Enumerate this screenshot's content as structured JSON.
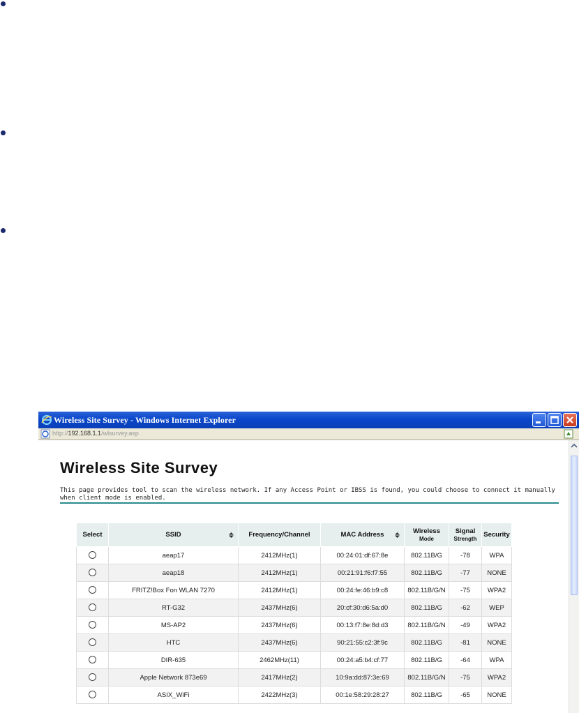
{
  "window": {
    "title": "Wireless Site Survey - Windows Internet Explorer",
    "url_prefix": "http://",
    "url_host": "192.168.1.1",
    "url_path": "/wlsurvey.asp"
  },
  "page": {
    "heading": "Wireless Site Survey",
    "description": "This page provides tool to scan the wireless network. If any Access Point or IBSS is found, you could choose to connect it manually when client mode is enabled."
  },
  "table": {
    "headers": {
      "select": "Select",
      "ssid": "SSID",
      "frequency": "Frequency/Channel",
      "mac": "MAC Address",
      "mode_line1": "Wireless",
      "mode_line2": "Mode",
      "signal_line1": "Signal",
      "signal_line2": "Strength",
      "security": "Security"
    },
    "rows": [
      {
        "ssid": "aeap17",
        "frequency": "2412MHz(1)",
        "mac": "00:24:01:df:67:8e",
        "mode": "802.11B/G",
        "signal": "-78",
        "security": "WPA"
      },
      {
        "ssid": "aeap18",
        "frequency": "2412MHz(1)",
        "mac": "00:21:91:f6:f7:55",
        "mode": "802.11B/G",
        "signal": "-77",
        "security": "NONE"
      },
      {
        "ssid": "FRITZ!Box Fon WLAN 7270",
        "frequency": "2412MHz(1)",
        "mac": "00:24:fe:46:b9:c8",
        "mode": "802.11B/G/N",
        "signal": "-75",
        "security": "WPA2"
      },
      {
        "ssid": "RT-G32",
        "frequency": "2437MHz(6)",
        "mac": "20:cf:30:d6:5a:d0",
        "mode": "802.11B/G",
        "signal": "-62",
        "security": "WEP"
      },
      {
        "ssid": "MS-AP2",
        "frequency": "2437MHz(6)",
        "mac": "00:13:f7:8e:8d:d3",
        "mode": "802.11B/G/N",
        "signal": "-49",
        "security": "WPA2"
      },
      {
        "ssid": "HTC",
        "frequency": "2437MHz(6)",
        "mac": "90:21:55:c2:3f:9c",
        "mode": "802.11B/G",
        "signal": "-81",
        "security": "NONE"
      },
      {
        "ssid": "DIR-635",
        "frequency": "2462MHz(11)",
        "mac": "00:24:a5:b4:cf:77",
        "mode": "802.11B/G",
        "signal": "-64",
        "security": "WPA"
      },
      {
        "ssid": "Apple Network 873e69",
        "frequency": "2417MHz(2)",
        "mac": "10:9a:dd:87:3e:69",
        "mode": "802.11B/G/N",
        "signal": "-75",
        "security": "WPA2"
      },
      {
        "ssid": "ASIX_WiFi",
        "frequency": "2422MHz(3)",
        "mac": "00:1e:58:29:28:27",
        "mode": "802.11B/G",
        "signal": "-65",
        "security": "NONE"
      }
    ]
  },
  "colors": {
    "titlebar": "#0a47c9",
    "rule": "#2a8a8a",
    "table_header_bg": "#e6eeee",
    "bullet": "#1a2a6c"
  },
  "icons": {
    "browser": "ie-icon",
    "minimize": "minimize-icon",
    "maximize": "maximize-icon",
    "close": "close-icon",
    "sort": "sort-arrows-icon"
  }
}
